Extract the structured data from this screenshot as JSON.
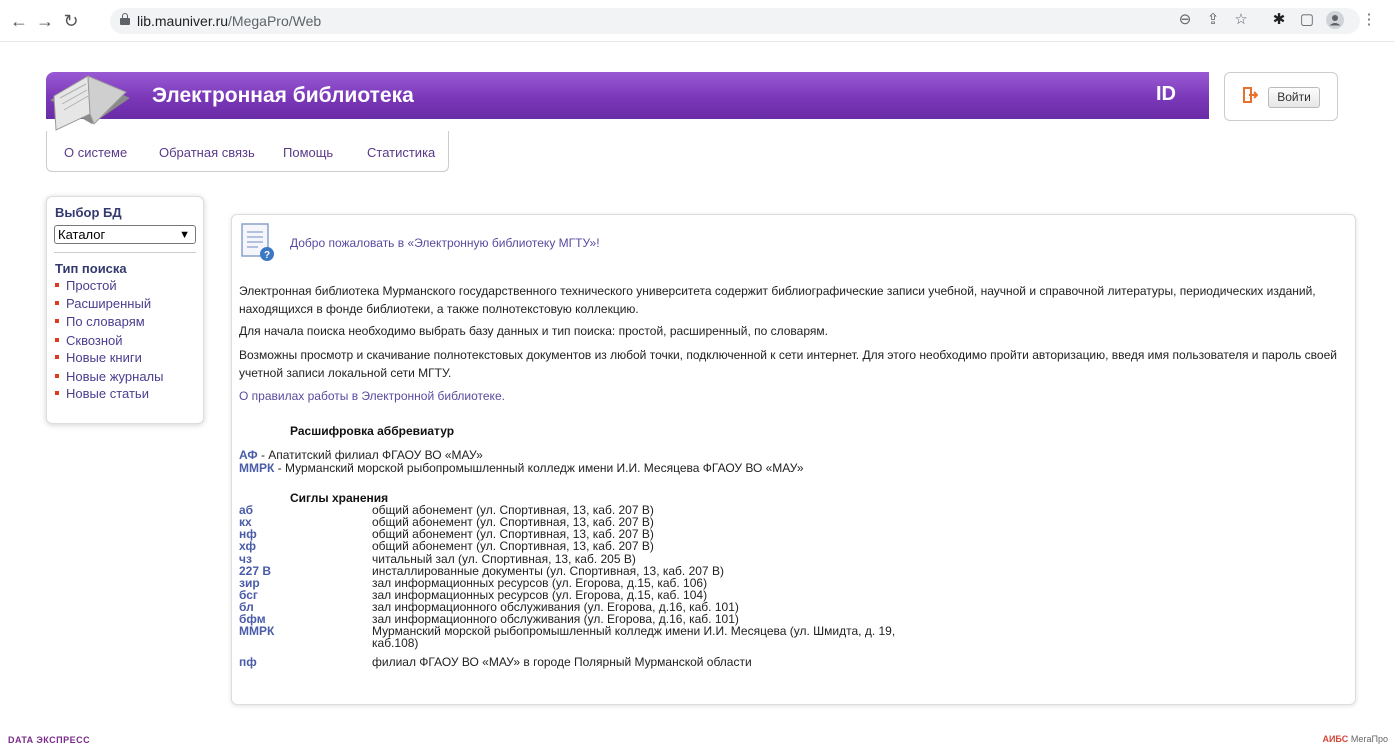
{
  "browser": {
    "url_host": "lib.mauniver.ru",
    "url_path": "/MegaPro/Web"
  },
  "header": {
    "title": "Электронная библиотека",
    "logo_text": "ID",
    "login_label": "Войти"
  },
  "menu": {
    "items": [
      "О системе",
      "Обратная связь",
      "Помощь",
      "Статистика"
    ]
  },
  "sidebar": {
    "db_heading": "Выбор БД",
    "db_selected": "Каталог",
    "search_heading": "Тип поиска",
    "search_types": [
      "Простой",
      "Расширенный",
      "По словарям",
      "Сквозной",
      "Новые книги",
      "Новые журналы",
      "Новые статьи"
    ]
  },
  "main": {
    "welcome": "Добро пожаловать в «Электронную библиотеку МГТУ»!",
    "paragraphs": [
      "Электронная библиотека Мурманского государственного технического университета содержит библиографические записи учебной, научной и справочной литературы, периодических изданий, находящихся в фонде библиотеки, а также полнотекстовую коллекцию.",
      "Для начала поиска необходимо выбрать базу данных и тип поиска: простой, расширенный, по словарям.",
      "Возможны просмотр и скачивание полнотекстовых документов из любой точки, подключенной к сети интернет. Для этого необходимо пройти авторизацию, введя имя пользователя и пароль своей учетной записи локальной сети МГТУ."
    ],
    "rules_link": "О правилах работы в Электронной библиотеке.",
    "abbr_heading": "Расшифровка аббревиатур",
    "abbreviations": [
      {
        "code": "АФ",
        "text": " - Апатитский филиал ФГАОУ ВО «МАУ»"
      },
      {
        "code": "ММРК",
        "text": " - Мурманский морской рыбопромышленный колледж имени И.И. Месяцева ФГАОУ ВО «МАУ»"
      }
    ],
    "sigla_heading": "Сиглы хранения",
    "sigla": [
      {
        "code": "аб",
        "desc": "общий абонемент (ул. Спортивная, 13, каб. 207 В)"
      },
      {
        "code": "кх",
        "desc": "общий абонемент (ул. Спортивная, 13, каб. 207 В)"
      },
      {
        "code": "нф",
        "desc": "общий абонемент (ул. Спортивная, 13, каб. 207 В)"
      },
      {
        "code": "хф",
        "desc": "общий абонемент (ул. Спортивная, 13, каб. 207 В)"
      },
      {
        "code": "чз",
        "desc": "читальный зал (ул. Спортивная, 13, каб. 205 В)"
      },
      {
        "code": "227 В",
        "desc": "инсталлированные документы (ул. Спортивная, 13, каб. 207 В)"
      },
      {
        "code": "зир",
        "desc": "зал информационных ресурсов (ул. Егорова, д.15, каб. 106)"
      },
      {
        "code": "бсг",
        "desc": "зал информационных ресурсов (ул. Егорова, д.15, каб. 104)"
      },
      {
        "code": "бл",
        "desc": "зал информационного обслуживания (ул. Егорова, д.16, каб. 101)"
      },
      {
        "code": "бфм",
        "desc": "зал информационного обслуживания (ул. Егорова, д.16, каб. 101)"
      },
      {
        "code": "ММРК",
        "desc": "Мурманский морской рыбопромышленный колледж имени И.И. Месяцева (ул. Шмидта, д. 19, каб.108)"
      },
      {
        "code": "пф",
        "desc": "филиал ФГАОУ ВО «МАУ» в городе Полярный Мурманской области"
      }
    ]
  },
  "footer": {
    "left": "DATA ЭКСПРЕСС",
    "right_aibs": "АИБС",
    "right_megapro": "МегаПро"
  }
}
